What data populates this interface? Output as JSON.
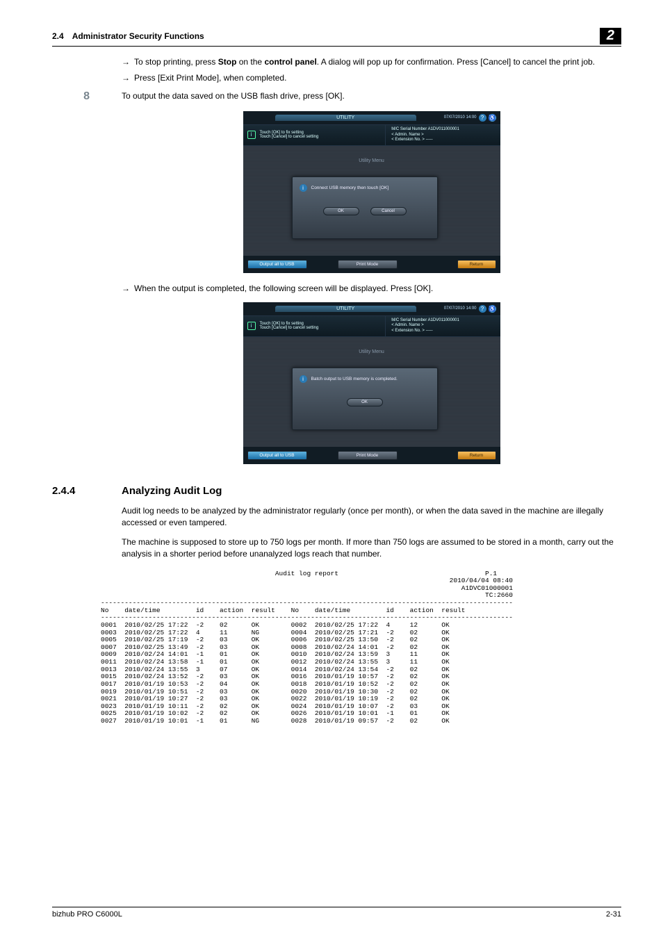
{
  "header": {
    "section_number": "2.4",
    "section_title": "Administrator Security Functions",
    "chapter": "2"
  },
  "body": {
    "bullet1a": "To stop printing, press ",
    "bullet1_bold1": "Stop",
    "bullet1b": " on the ",
    "bullet1_bold2": "control panel",
    "bullet1c": ". A dialog will pop up for confirmation. Press [Cancel] to cancel the print job.",
    "bullet2": "Press [Exit Print Mode], when completed.",
    "step8_num": "8",
    "step8_text": "To output the data saved on the USB flash drive, press [OK].",
    "bullet3": "When the output is completed, the following screen will be displayed. Press [OK]."
  },
  "ss1": {
    "tab": "UTILITY",
    "datetime": "07/07/2010 14:00",
    "hint1": "Touch [OK] to fix setting",
    "hint2": "Touch [Cancel] to cancel setting",
    "serial": "M/C Serial Number A1DV011000001",
    "admin": "< Admin. Name >",
    "ext": "< Extension No. > -----",
    "subtab": "Utility Menu",
    "dialog_text": "Connect USB memory then touch [OK]",
    "btn_ok": "OK",
    "btn_cancel": "Cancel",
    "f_blue": "Output all to USB",
    "f_gray": "Print Mode",
    "f_orange": "Return"
  },
  "ss2": {
    "dialog_text": "Batch output to USB memory is completed."
  },
  "sec244": {
    "num": "2.4.4",
    "title": "Analyzing Audit Log",
    "p1": "Audit log needs to be analyzed by the administrator regularly (once per month), or when the data saved in the machine are illegally accessed or even tampered.",
    "p2": "The machine is supposed to store up to 750 logs per month. If more than 750 logs are assumed to be stored in a month, carry out the analysis in a shorter period before unanalyzed logs reach that number."
  },
  "audit": {
    "title": "Audit log report",
    "meta1": "P.1",
    "meta2": "2010/04/04 08:40",
    "meta3": "A1DVC01000001",
    "meta4": "TC:2660",
    "h_no": "No",
    "h_dt": "date/time",
    "h_id": "id",
    "h_action": "action",
    "h_result": "result",
    "rows_left": [
      {
        "no": "0001",
        "dt": "2010/02/25 17:22",
        "id": "-2",
        "action": "02",
        "result": "OK"
      },
      {
        "no": "0003",
        "dt": "2010/02/25 17:22",
        "id": "4",
        "action": "11",
        "result": "NG"
      },
      {
        "no": "0005",
        "dt": "2010/02/25 17:19",
        "id": "-2",
        "action": "03",
        "result": "OK"
      },
      {
        "no": "0007",
        "dt": "2010/02/25 13:49",
        "id": "-2",
        "action": "03",
        "result": "OK"
      },
      {
        "no": "0009",
        "dt": "2010/02/24 14:01",
        "id": "-1",
        "action": "01",
        "result": "OK"
      },
      {
        "no": "0011",
        "dt": "2010/02/24 13:58",
        "id": "-1",
        "action": "01",
        "result": "OK"
      },
      {
        "no": "0013",
        "dt": "2010/02/24 13:55",
        "id": "3",
        "action": "07",
        "result": "OK"
      },
      {
        "no": "0015",
        "dt": "2010/02/24 13:52",
        "id": "-2",
        "action": "03",
        "result": "OK"
      },
      {
        "no": "0017",
        "dt": "2010/01/19 10:53",
        "id": "-2",
        "action": "04",
        "result": "OK"
      },
      {
        "no": "0019",
        "dt": "2010/01/19 10:51",
        "id": "-2",
        "action": "03",
        "result": "OK"
      },
      {
        "no": "0021",
        "dt": "2010/01/19 10:27",
        "id": "-2",
        "action": "03",
        "result": "OK"
      },
      {
        "no": "0023",
        "dt": "2010/01/19 10:11",
        "id": "-2",
        "action": "02",
        "result": "OK"
      },
      {
        "no": "0025",
        "dt": "2010/01/19 10:02",
        "id": "-2",
        "action": "02",
        "result": "OK"
      },
      {
        "no": "0027",
        "dt": "2010/01/19 10:01",
        "id": "-1",
        "action": "01",
        "result": "NG"
      }
    ],
    "rows_right": [
      {
        "no": "0002",
        "dt": "2010/02/25 17:22",
        "id": "4",
        "action": "12",
        "result": "OK"
      },
      {
        "no": "0004",
        "dt": "2010/02/25 17:21",
        "id": "-2",
        "action": "02",
        "result": "OK"
      },
      {
        "no": "0006",
        "dt": "2010/02/25 13:50",
        "id": "-2",
        "action": "02",
        "result": "OK"
      },
      {
        "no": "0008",
        "dt": "2010/02/24 14:01",
        "id": "-2",
        "action": "02",
        "result": "OK"
      },
      {
        "no": "0010",
        "dt": "2010/02/24 13:59",
        "id": "3",
        "action": "11",
        "result": "OK"
      },
      {
        "no": "0012",
        "dt": "2010/02/24 13:55",
        "id": "3",
        "action": "11",
        "result": "OK"
      },
      {
        "no": "0014",
        "dt": "2010/02/24 13:54",
        "id": "-2",
        "action": "02",
        "result": "OK"
      },
      {
        "no": "0016",
        "dt": "2010/01/19 10:57",
        "id": "-2",
        "action": "02",
        "result": "OK"
      },
      {
        "no": "0018",
        "dt": "2010/01/19 10:52",
        "id": "-2",
        "action": "02",
        "result": "OK"
      },
      {
        "no": "0020",
        "dt": "2010/01/19 10:30",
        "id": "-2",
        "action": "02",
        "result": "OK"
      },
      {
        "no": "0022",
        "dt": "2010/01/19 10:19",
        "id": "-2",
        "action": "02",
        "result": "OK"
      },
      {
        "no": "0024",
        "dt": "2010/01/19 10:07",
        "id": "-2",
        "action": "03",
        "result": "OK"
      },
      {
        "no": "0026",
        "dt": "2010/01/19 10:01",
        "id": "-1",
        "action": "01",
        "result": "OK"
      },
      {
        "no": "0028",
        "dt": "2010/01/19 09:57",
        "id": "-2",
        "action": "02",
        "result": "OK"
      }
    ]
  },
  "footer": {
    "left": "bizhub PRO C6000L",
    "right": "2-31"
  }
}
